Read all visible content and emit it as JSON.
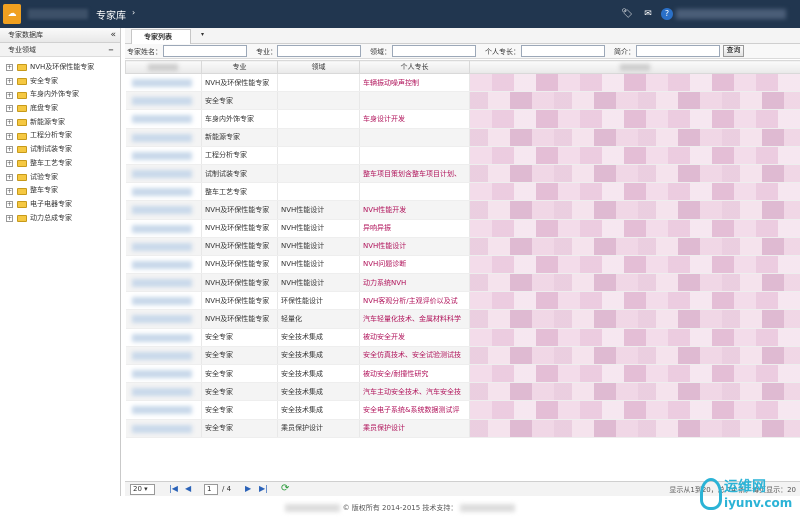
{
  "header": {
    "logo_glyph": "☁",
    "title": "专家库",
    "caret": "›",
    "icons": [
      "tag-icon",
      "message-icon",
      "help-icon"
    ]
  },
  "sidebar": {
    "title": "专家数据库",
    "collapse_glyph": "«",
    "section": "专业领域",
    "section_toggle": "−",
    "items": [
      "NVH及环保性能专家",
      "安全专家",
      "车身内外饰专家",
      "底盘专家",
      "新能源专家",
      "工程分析专家",
      "试制试装专家",
      "整车工艺专家",
      "试验专家",
      "整车专家",
      "电子电器专家",
      "动力总成专家"
    ]
  },
  "tab": {
    "label": "专家列表",
    "menu_glyph": "▾"
  },
  "filters": {
    "name_label": "专家姓名：",
    "major_label": "专业：",
    "field_label": "领域：",
    "specialty_label": "个人专长：",
    "intro_label": "简介：",
    "search_button": "查询"
  },
  "table": {
    "columns": [
      "专业",
      "领域",
      "个人专长"
    ],
    "rows": [
      {
        "major": "NVH及环保性能专家",
        "field": "",
        "specialty": "车辆振动噪声控制"
      },
      {
        "major": "安全专家",
        "field": "",
        "specialty": ""
      },
      {
        "major": "车身内外饰专家",
        "field": "",
        "specialty": "车身设计开发"
      },
      {
        "major": "新能源专家",
        "field": "",
        "specialty": ""
      },
      {
        "major": "工程分析专家",
        "field": "",
        "specialty": ""
      },
      {
        "major": "试制试装专家",
        "field": "",
        "specialty": "整车项目策划含整车项目计划、"
      },
      {
        "major": "整车工艺专家",
        "field": "",
        "specialty": ""
      },
      {
        "major": "NVH及环保性能专家",
        "field": "NVH性能设计",
        "specialty": "NVH性能开发"
      },
      {
        "major": "NVH及环保性能专家",
        "field": "NVH性能设计",
        "specialty": "异响异振"
      },
      {
        "major": "NVH及环保性能专家",
        "field": "NVH性能设计",
        "specialty": "NVH性能设计"
      },
      {
        "major": "NVH及环保性能专家",
        "field": "NVH性能设计",
        "specialty": "NVH问题诊断"
      },
      {
        "major": "NVH及环保性能专家",
        "field": "NVH性能设计",
        "specialty": "动力系统NVH"
      },
      {
        "major": "NVH及环保性能专家",
        "field": "环保性能设计",
        "specialty": "NVH客观分析/主观评价以及试"
      },
      {
        "major": "NVH及环保性能专家",
        "field": "轻量化",
        "specialty": "汽车轻量化技术、金属材料科学"
      },
      {
        "major": "安全专家",
        "field": "安全技术集成",
        "specialty": "被动安全开发"
      },
      {
        "major": "安全专家",
        "field": "安全技术集成",
        "specialty": "安全仿真技术、安全试验测试技"
      },
      {
        "major": "安全专家",
        "field": "安全技术集成",
        "specialty": "被动安全/耐撞性研究"
      },
      {
        "major": "安全专家",
        "field": "安全技术集成",
        "specialty": "汽车主动安全技术、汽车安全技"
      },
      {
        "major": "安全专家",
        "field": "安全技术集成",
        "specialty": "安全电子系统&系统数据测试评"
      },
      {
        "major": "安全专家",
        "field": "乘员保护设计",
        "specialty": "乘员保护设计"
      }
    ]
  },
  "pager": {
    "page_size": "20",
    "first": "|◀",
    "prev": "◀",
    "current_page": "1",
    "total_pages": "/ 4",
    "next": "▶",
    "last": "▶|",
    "refresh": "⟳",
    "info": "显示从1到20，总 74 条，每页显示：20"
  },
  "footer": {
    "copyright": "© 版权所有 2014-2015 技术支持："
  },
  "watermark": {
    "cn": "运维网",
    "en": "iyunv.com"
  }
}
